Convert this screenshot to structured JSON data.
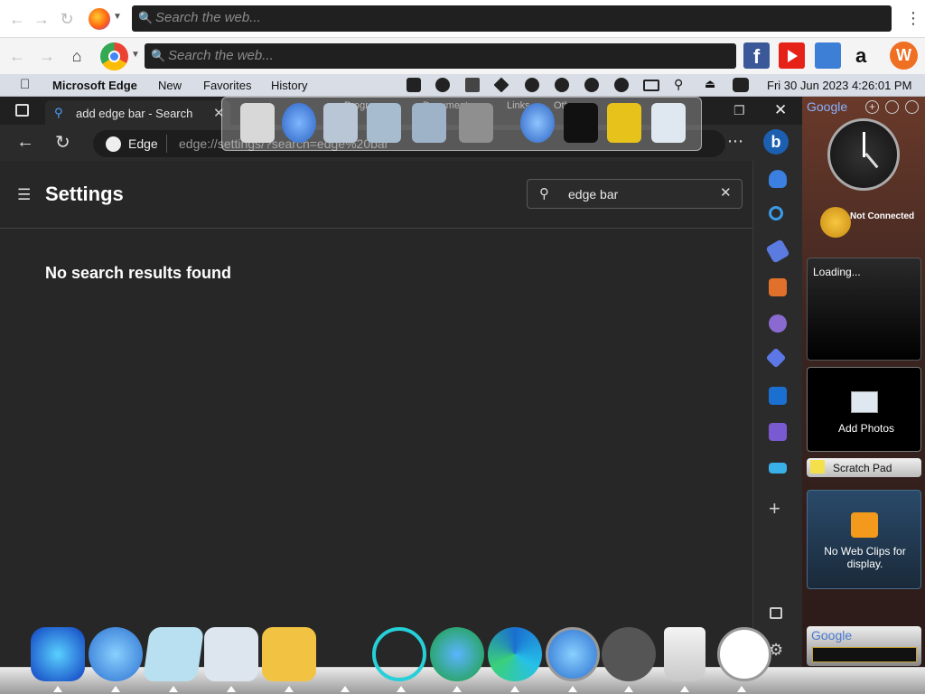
{
  "firefox_bar": {
    "search_placeholder": "Search the web..."
  },
  "chrome_bar": {
    "search_placeholder": "Search the web..."
  },
  "menubar": {
    "app_name": "Microsoft Edge",
    "items": [
      "New",
      "Favorites",
      "History"
    ],
    "datetime": "Fri 30 Jun 2023 4:26:01 PM"
  },
  "edge": {
    "tab_title": "add edge bar - Search",
    "address_label": "Edge",
    "address_url": "edge://settings/?search=edge%20bar",
    "page_title": "Settings",
    "search_value": "edge bar",
    "no_results": "No search results found"
  },
  "float_dock": {
    "labels": [
      "Programs",
      "Documents",
      "Links",
      "Oth"
    ]
  },
  "gadgets": {
    "header": "Google",
    "weather": "Not Connected",
    "loading": "Loading...",
    "photos": "Add Photos",
    "scratch": "Scratch Pad",
    "webclips": "No Web Clips for display.",
    "footer": "Google"
  },
  "colors": {
    "accent": "#0078d4",
    "edge_bg": "#272727"
  }
}
